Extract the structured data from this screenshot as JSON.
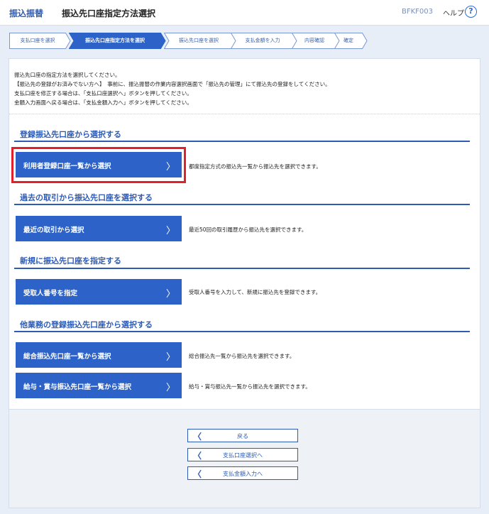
{
  "header": {
    "section": "振込振替",
    "title": "振込先口座指定方法選択",
    "screen_code": "BFKF003",
    "help_label": "ヘルプ",
    "help_icon": "?"
  },
  "steps": [
    {
      "label": "支払口座を選択"
    },
    {
      "label": "振込先口座指定方法を選択",
      "active": true
    },
    {
      "label": "振込先口座を選択"
    },
    {
      "label": "支払金額を入力"
    },
    {
      "label": "内容確認"
    },
    {
      "label": "確定"
    }
  ],
  "intro": {
    "lines": [
      "振込先口座の指定方法を選択してください。",
      "【振込先の登録がお済みでない方へ】　事前に、振込振替の作業内容選択画面で「振込先の管理」にて振込先の登録をしてください。",
      "支払口座を修正する場合は、「支払口座選択へ」ボタンを押してください。",
      "金額入力画面へ戻る場合は、「支払金額入力へ」ボタンを押してください。"
    ]
  },
  "sections": [
    {
      "heading": "登録振込先口座から選択する",
      "options": [
        {
          "label": "利用者登録口座一覧から選択",
          "chevron": "〉",
          "description": "都度指定方式の振込先一覧から振込先を選択できます。"
        }
      ]
    },
    {
      "heading": "過去の取引から振込先口座を選択する",
      "options": [
        {
          "label": "最近の取引から選択",
          "chevron": "〉",
          "description": "最近50回の取引履歴から振込先を選択できます。"
        }
      ]
    },
    {
      "heading": "新規に振込先口座を指定する",
      "options": [
        {
          "label": "受取人番号を指定",
          "chevron": "〉",
          "description": "受取人番号を入力して、新規に振込先を登録できます。"
        }
      ]
    },
    {
      "heading": "他業務の登録振込先口座から選択する",
      "options": [
        {
          "label": "総合振込先口座一覧から選択",
          "chevron": "〉",
          "description": "総合振込先一覧から振込先を選択できます。"
        },
        {
          "label": "給与・賞与振込先口座一覧から選択",
          "chevron": "〉",
          "description": "給与・賞与振込先一覧から振込先を選択できます。"
        }
      ]
    }
  ],
  "footer": {
    "buttons": [
      {
        "label": "戻る",
        "chevron": "〈"
      },
      {
        "label": "支払口座選択へ",
        "chevron": "〈"
      },
      {
        "label": "支払金額入力へ",
        "chevron": "〈"
      }
    ]
  },
  "colors": {
    "accent": "#2d63c8",
    "heading": "#2d5bb5",
    "highlight": "#e0202a",
    "background": "#e8eef7"
  }
}
